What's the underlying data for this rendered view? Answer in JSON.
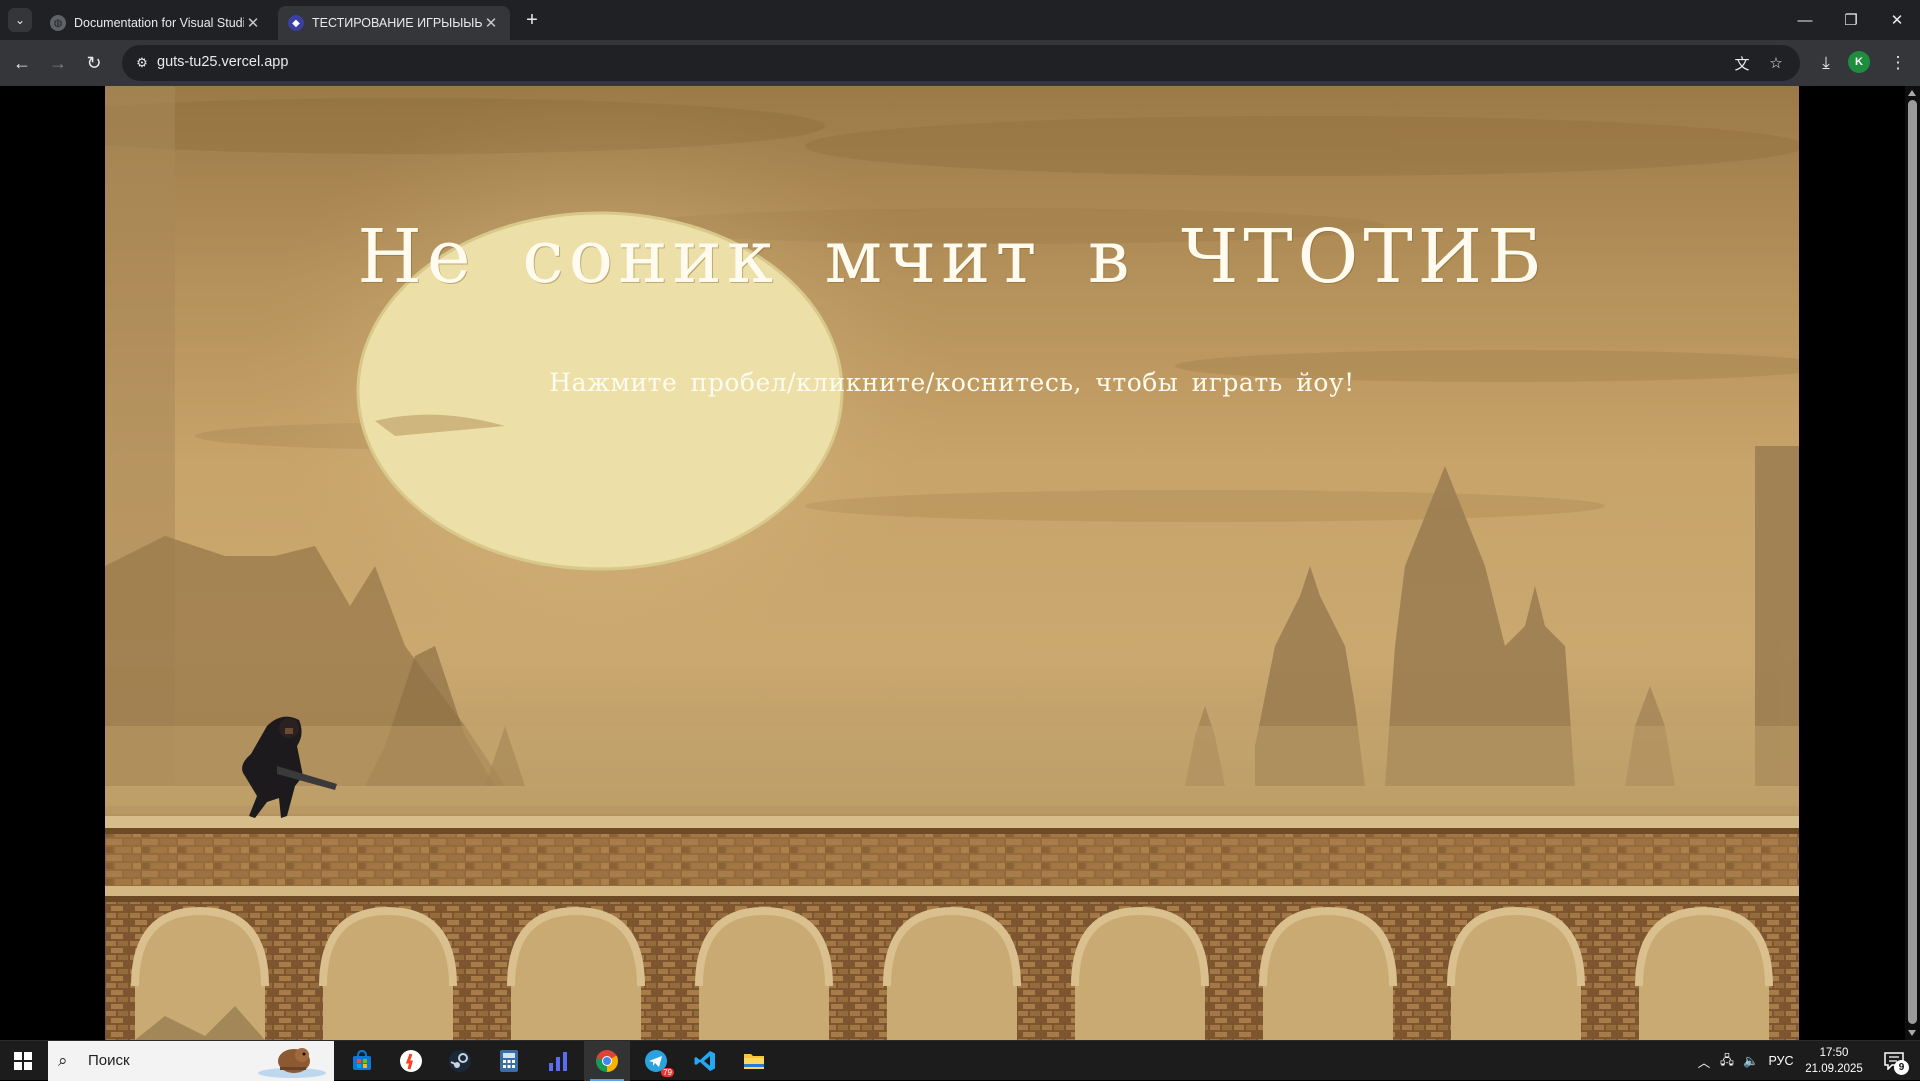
{
  "browser": {
    "tabs": [
      {
        "title": "Documentation for Visual Studio",
        "favicon": "globe-icon",
        "active": false
      },
      {
        "title": "ТЕСТИРОВАНИЕ ИГРЫЫЫЫ",
        "favicon": "game-icon",
        "active": true
      }
    ],
    "url": "guts-tu25.vercel.app",
    "profile_initial": "K",
    "accent": "#35363a"
  },
  "game": {
    "title": "Не соник мчит в ЧТОТИБ",
    "subtitle": "Нажмите пробел/кликните/коснитесь, чтобы играть йоу!"
  },
  "taskbar": {
    "search_placeholder": "Поиск",
    "telegram_badge": "79",
    "language": "РУС",
    "time": "17:50",
    "date": "21.09.2025",
    "notifications": "9",
    "active_app": "chrome"
  }
}
